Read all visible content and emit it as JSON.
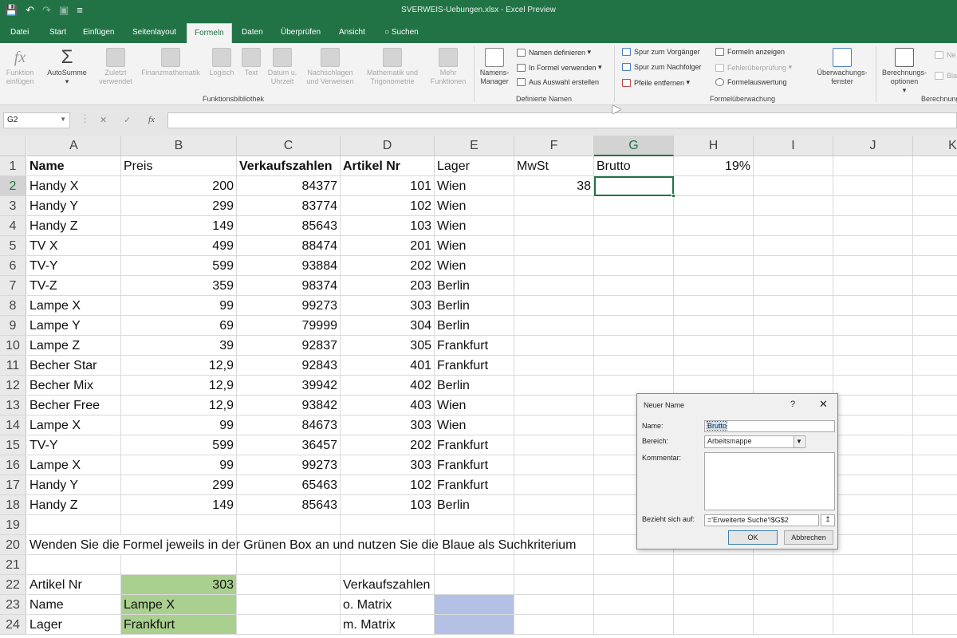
{
  "window": {
    "title": "SVERWEIS-Uebungen.xlsx  -  Excel Preview",
    "qat": [
      "save-icon",
      "undo-icon",
      "redo-icon",
      "camera-icon",
      "customize-icon"
    ]
  },
  "menu_tabs": [
    "Datei",
    "Start",
    "Einfügen",
    "Seitenlayout",
    "Formeln",
    "Daten",
    "Überprüfen",
    "Ansicht",
    "Suchen"
  ],
  "ribbon": {
    "funktionsbibliothek": {
      "label": "Funktionsbibliothek",
      "buttons": [
        "Funktion einfügen",
        "AutoSumme",
        "Zuletzt verwendet",
        "Finanzmathematik",
        "Logisch",
        "Text",
        "Datum u. Uhrzeit",
        "Nachschlagen und Verweisen",
        "Mathematik und Trigonometrie",
        "Mehr Funktionen"
      ]
    },
    "definierte_namen": {
      "label": "Definierte Namen",
      "manager": "Namens-Manager",
      "items": [
        "Namen definieren",
        "In Formel verwenden",
        "Aus Auswahl erstellen"
      ]
    },
    "formelueberwachung": {
      "label": "Formelüberwachung",
      "items_left": [
        "Spur zum Vorgänger",
        "Spur zum Nachfolger",
        "Pfeile entfernen"
      ],
      "items_right": [
        "Formeln anzeigen",
        "Fehlerüberprüfung",
        "Formelauswertung"
      ],
      "watch": "Überwachungs-fenster"
    },
    "berechnung": {
      "label": "Berechnung",
      "options": "Berechnungs-optionen",
      "partial": [
        "Ne",
        "Bla"
      ]
    }
  },
  "formula_bar": {
    "name_box": "G2",
    "content": ""
  },
  "columns": [
    "A",
    "B",
    "C",
    "D",
    "E",
    "F",
    "G",
    "H",
    "I",
    "J",
    "K"
  ],
  "selected_column": "G",
  "rows": [
    {
      "n": "1",
      "A": "Name",
      "B": "Preis",
      "C": "Verkaufszahlen",
      "D": "Artikel Nr",
      "E": "Lager",
      "F": "MwSt",
      "G": "Brutto",
      "H": "19%"
    },
    {
      "n": "2",
      "A": "Handy X",
      "B": "200",
      "C": "84377",
      "D": "101",
      "E": "Wien",
      "F": "38"
    },
    {
      "n": "3",
      "A": "Handy Y",
      "B": "299",
      "C": "83774",
      "D": "102",
      "E": "Wien"
    },
    {
      "n": "4",
      "A": "Handy Z",
      "B": "149",
      "C": "85643",
      "D": "103",
      "E": "Wien"
    },
    {
      "n": "5",
      "A": "TV X",
      "B": "499",
      "C": "88474",
      "D": "201",
      "E": "Wien"
    },
    {
      "n": "6",
      "A": "TV-Y",
      "B": "599",
      "C": "93884",
      "D": "202",
      "E": "Wien"
    },
    {
      "n": "7",
      "A": "TV-Z",
      "B": "359",
      "C": "98374",
      "D": "203",
      "E": "Berlin"
    },
    {
      "n": "8",
      "A": "Lampe X",
      "B": "99",
      "C": "99273",
      "D": "303",
      "E": "Berlin"
    },
    {
      "n": "9",
      "A": "Lampe Y",
      "B": "69",
      "C": "79999",
      "D": "304",
      "E": "Berlin"
    },
    {
      "n": "10",
      "A": "Lampe Z",
      "B": "39",
      "C": "92837",
      "D": "305",
      "E": "Frankfurt"
    },
    {
      "n": "11",
      "A": "Becher Star",
      "B": "12,9",
      "C": "92843",
      "D": "401",
      "E": "Frankfurt"
    },
    {
      "n": "12",
      "A": "Becher Mix",
      "B": "12,9",
      "C": "39942",
      "D": "402",
      "E": "Berlin"
    },
    {
      "n": "13",
      "A": "Becher Free",
      "B": "12,9",
      "C": "93842",
      "D": "403",
      "E": "Wien"
    },
    {
      "n": "14",
      "A": "Lampe X",
      "B": "99",
      "C": "84673",
      "D": "303",
      "E": "Wien"
    },
    {
      "n": "15",
      "A": "TV-Y",
      "B": "599",
      "C": "36457",
      "D": "202",
      "E": "Frankfurt"
    },
    {
      "n": "16",
      "A": "Lampe X",
      "B": "99",
      "C": "99273",
      "D": "303",
      "E": "Frankfurt"
    },
    {
      "n": "17",
      "A": "Handy Y",
      "B": "299",
      "C": "65463",
      "D": "102",
      "E": "Frankfurt"
    },
    {
      "n": "18",
      "A": "Handy Z",
      "B": "149",
      "C": "85643",
      "D": "103",
      "E": "Berlin"
    },
    {
      "n": "19"
    },
    {
      "n": "20",
      "A": "Wenden Sie die Formel jeweils in der Grünen Box an und nutzen Sie die Blaue als Suchkriterium"
    },
    {
      "n": "21"
    },
    {
      "n": "22",
      "A": "Artikel Nr",
      "B": "303",
      "D": "Verkaufszahlen"
    },
    {
      "n": "23",
      "A": "Name",
      "B": "Lampe X",
      "D": "o. Matrix"
    },
    {
      "n": "24",
      "A": "Lager",
      "B": "Frankfurt",
      "D": "m. Matrix"
    }
  ],
  "colors": {
    "excel_green": "#217346",
    "green_box": "#a9d08e",
    "blue_box": "#b4c0e4"
  },
  "dialog": {
    "title": "Neuer Name",
    "help": "?",
    "close": "✕",
    "name_label": "Name:",
    "name_value": "Brutto",
    "scope_label": "Bereich:",
    "scope_value": "Arbeitsmappe",
    "comment_label": "Kommentar:",
    "refers_label": "Bezieht sich auf:",
    "refers_value": "='Erweiterte Suche'!$G$2",
    "ok": "OK",
    "cancel": "Abbrechen"
  }
}
